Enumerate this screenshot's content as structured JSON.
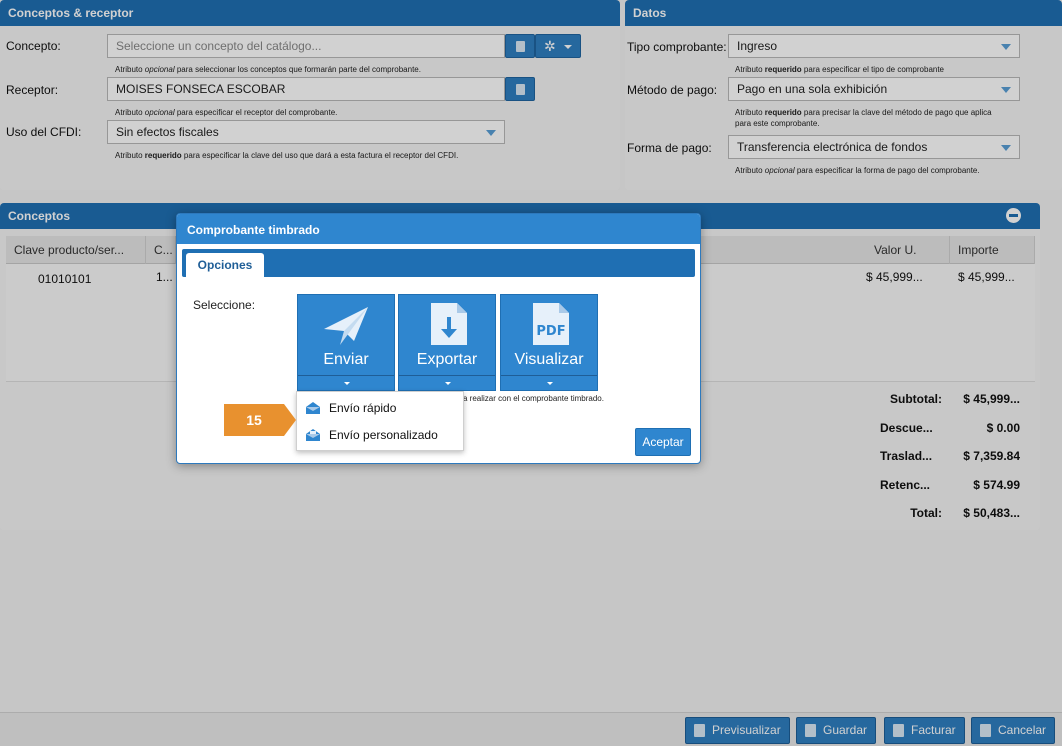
{
  "conceptos_receptor": {
    "title": "Conceptos & receptor",
    "concepto_label": "Concepto:",
    "concepto_placeholder": "Seleccione un concepto del catálogo...",
    "concepto_hint_pre": "Atributo ",
    "concepto_hint_em": "opcional",
    "concepto_hint_post": " para seleccionar los conceptos que formarán parte del comprobante.",
    "receptor_label": "Receptor:",
    "receptor_value": "MOISES FONSECA ESCOBAR",
    "receptor_hint_pre": "Atributo ",
    "receptor_hint_em": "opcional",
    "receptor_hint_post": " para especificar el receptor del comprobante.",
    "uso_label": "Uso del CFDI:",
    "uso_value": "Sin efectos fiscales",
    "uso_hint_pre": "Atributo ",
    "uso_hint_b": "requerido",
    "uso_hint_post": " para especificar la clave del uso que dará a esta factura el receptor del CFDI."
  },
  "datos": {
    "title": "Datos",
    "tipo_label": "Tipo comprobante:",
    "tipo_value": "Ingreso",
    "tipo_hint_pre": "Atributo ",
    "tipo_hint_b": "requerido",
    "tipo_hint_post": " para especificar el tipo de comprobante",
    "metodo_label": "Método de pago:",
    "metodo_value": "Pago en una sola exhibición",
    "metodo_hint_pre": "Atributo ",
    "metodo_hint_b": "requerido",
    "metodo_hint_post": " para precisar la clave del método de pago que aplica",
    "metodo_hint_line2": "para este comprobante.",
    "forma_label": "Forma de pago:",
    "forma_value": "Transferencia electrónica de fondos",
    "forma_hint_pre": "Atributo ",
    "forma_hint_em": "opcional",
    "forma_hint_post": " para especificar la forma de pago del comprobante."
  },
  "conceptos": {
    "title": "Conceptos",
    "columns": [
      "Clave producto/ser...",
      "C...",
      "Valor U.",
      "Importe"
    ],
    "row": {
      "clave": "01010101",
      "c": "1...",
      "valor": "$ 45,999...",
      "importe": "$ 45,999..."
    }
  },
  "totals": [
    {
      "label": "Subtotal:",
      "value": "$ 45,999..."
    },
    {
      "label": "Descue...",
      "value": "$ 0.00"
    },
    {
      "label": "Traslad...",
      "value": "$ 7,359.84"
    },
    {
      "label": "Retenc...",
      "value": "$ 574.99"
    },
    {
      "label": "Total:",
      "value": "$ 50,483..."
    }
  ],
  "footer": {
    "previsualizar": "Previsualizar",
    "guardar": "Guardar",
    "facturar": "Facturar",
    "cancelar": "Cancelar"
  },
  "modal": {
    "title": "Comprobante timbrado",
    "tab": "Opciones",
    "seleccione": "Seleccione:",
    "enviar": "Enviar",
    "exportar": "Exportar",
    "visualizar": "Visualizar",
    "pdf_text": "PDF",
    "hint": "a realizar con el comprobante timbrado.",
    "aceptar": "Aceptar"
  },
  "menu": {
    "items": [
      "Envío rápido",
      "Envío personalizado"
    ]
  },
  "callout": {
    "number": "15"
  },
  "colors": {
    "header_blue": "#1f6fb3",
    "button_blue": "#2f86cf",
    "callout_orange": "#e8912f"
  }
}
